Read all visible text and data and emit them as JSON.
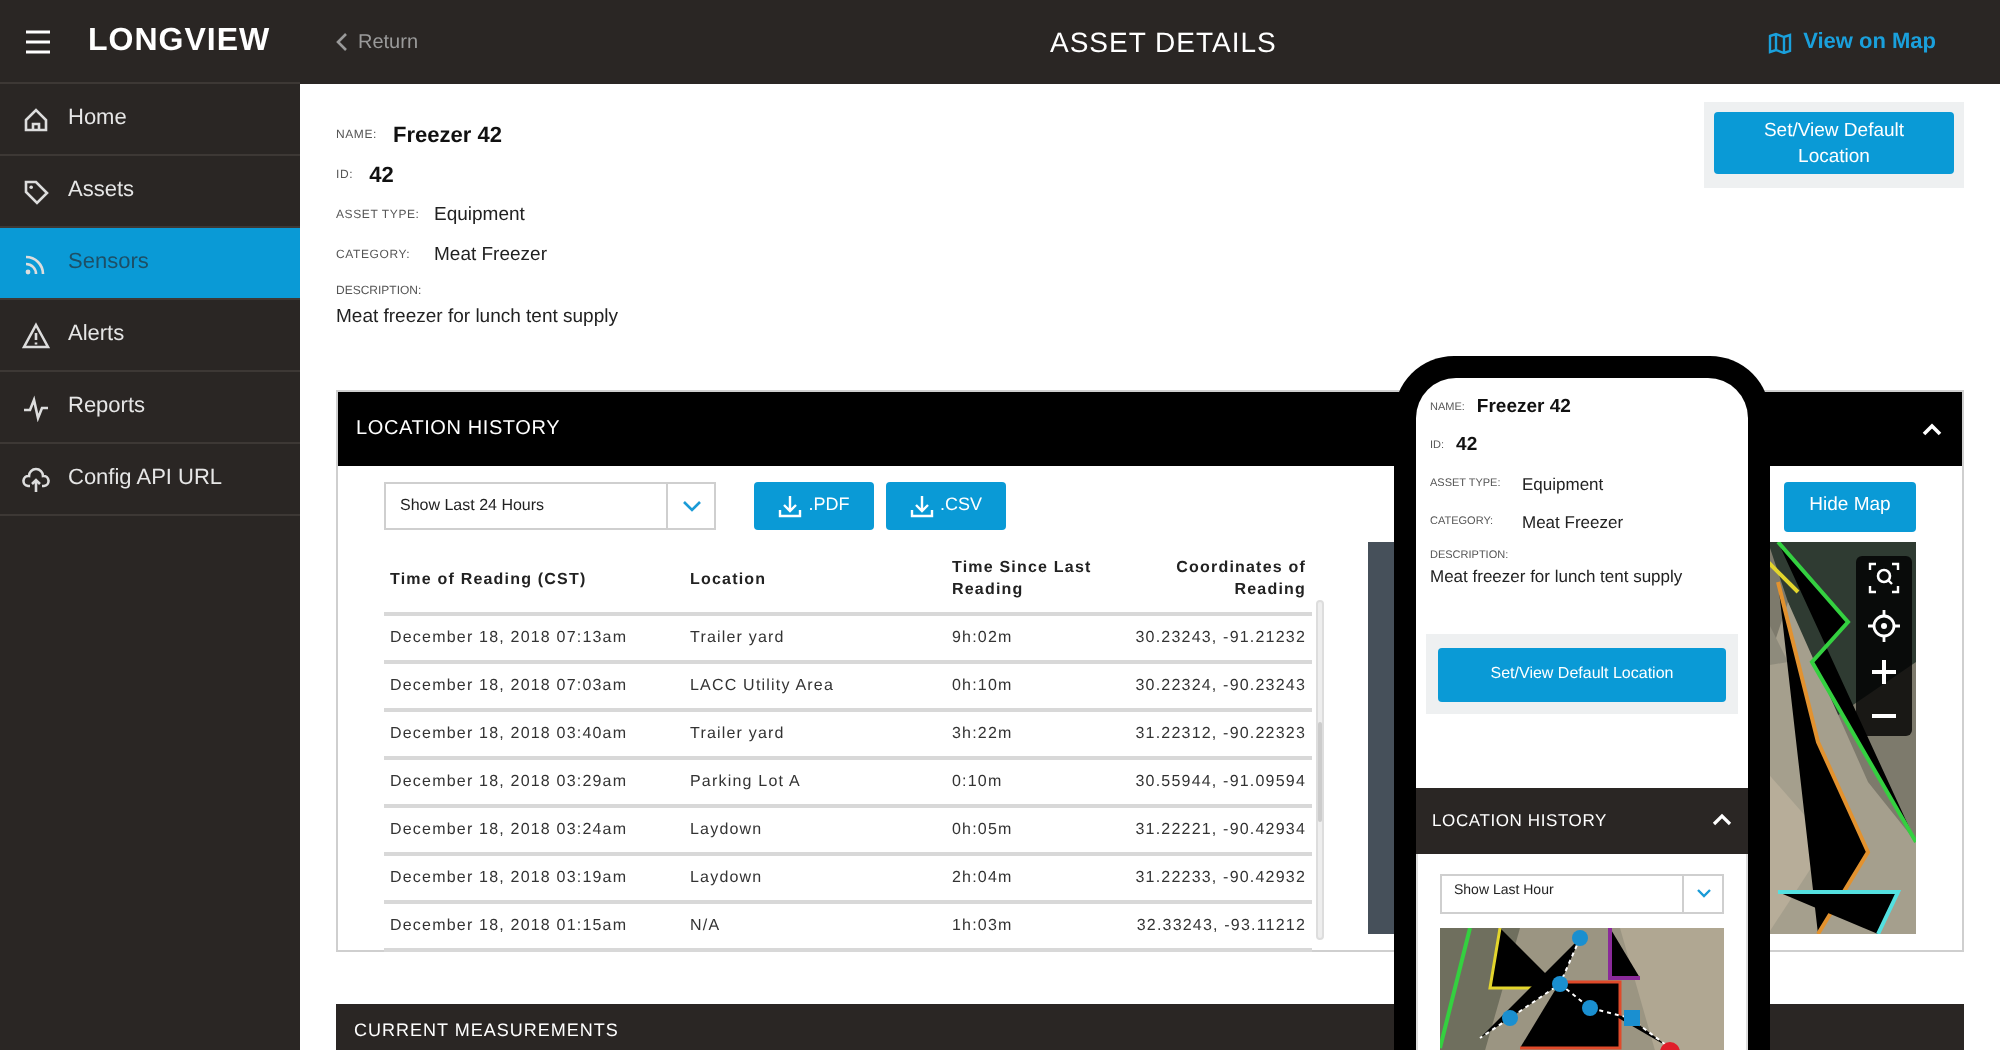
{
  "app": {
    "logo": "LONGVIEW"
  },
  "sidebar": {
    "items": [
      {
        "label": "Home",
        "selected": false
      },
      {
        "label": "Assets",
        "selected": false
      },
      {
        "label": "Sensors",
        "selected": true
      },
      {
        "label": "Alerts",
        "selected": false
      },
      {
        "label": "Reports",
        "selected": false
      },
      {
        "label": "Config API URL",
        "selected": false
      }
    ]
  },
  "header": {
    "back": "Return",
    "title": "ASSET DETAILS",
    "map_link": "View on Map"
  },
  "asset": {
    "fields": [
      {
        "label": "NAME:",
        "value": "Freezer 42",
        "kind": "title"
      },
      {
        "label": "ID:",
        "value": "42",
        "kind": "title"
      },
      {
        "label": "ASSET TYPE:",
        "value": "Equipment",
        "kind": "plain"
      },
      {
        "label": "CATEGORY:",
        "value": "Meat Freezer",
        "kind": "plain"
      }
    ],
    "description_label": "DESCRIPTION:",
    "description": "Meat freezer for lunch tent supply"
  },
  "default_location_button": "Set/View Default Location",
  "location_history": {
    "title": "LOCATION HISTORY",
    "expanded": true,
    "filter": "Show Last 24 Hours",
    "exports": [
      ".PDF",
      ".CSV"
    ],
    "hide_map": "Hide Map",
    "table": {
      "columns": [
        "Time of Reading (CST)",
        "Location",
        "Time Since Last Reading",
        "Coordinates of Reading"
      ],
      "rows": [
        [
          "December 18, 2018 07:13am",
          "Trailer yard",
          "9h:02m",
          "30.23243, -91.21232"
        ],
        [
          "December 18, 2018 07:03am",
          "LACC Utility Area",
          "0h:10m",
          "30.22324, -90.23243"
        ],
        [
          "December 18, 2018 03:40am",
          "Trailer yard",
          "3h:22m",
          "31.22312, -90.22323"
        ],
        [
          "December 18, 2018 03:29am",
          "Parking Lot A",
          "0:10m",
          "30.55944, -91.09594"
        ],
        [
          "December 18, 2018 03:24am",
          "Laydown",
          "0h:05m",
          "31.22221, -90.42934"
        ],
        [
          "December 18, 2018 03:19am",
          "Laydown",
          "2h:04m",
          "31.22233, -90.42932"
        ],
        [
          "December 18, 2018 01:15am",
          "N/A",
          "1h:03m",
          "32.33243, -93.11212"
        ]
      ]
    }
  },
  "current_measurements": {
    "title": "CURRENT MEASUREMENTS"
  },
  "phone": {
    "fields": [
      {
        "label": "NAME:",
        "value": "Freezer 42",
        "kind": "title"
      },
      {
        "label": "ID:",
        "value": "42",
        "kind": "title"
      },
      {
        "label": "ASSET TYPE:",
        "value": "Equipment",
        "kind": "plain"
      },
      {
        "label": "CATEGORY:",
        "value": "Meat Freezer",
        "kind": "plain"
      }
    ],
    "description_label": "DESCRIPTION:",
    "description": "Meat freezer for lunch tent supply",
    "default_location_button": "Set/View Default Location",
    "location_history": {
      "title": "LOCATION HISTORY",
      "expanded": true,
      "filter": "Show Last Hour"
    }
  }
}
